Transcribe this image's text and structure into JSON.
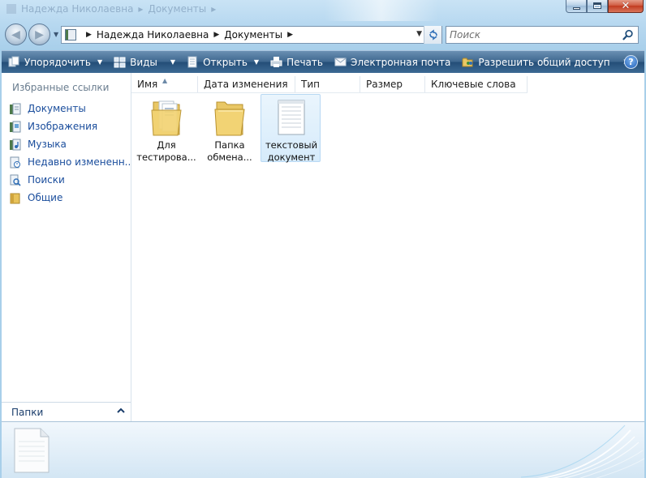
{
  "window": {
    "ghost_title_parts": [
      "Надежда Николаевна",
      "Документы"
    ],
    "caption_buttons": {
      "minimize": "minimize",
      "maximize": "maximize",
      "close": "close"
    }
  },
  "address_bar": {
    "breadcrumbs": [
      "Надежда Николаевна",
      "Документы"
    ]
  },
  "search": {
    "placeholder": "Поиск"
  },
  "toolbar": {
    "organize": "Упорядочить",
    "views": "Виды",
    "open": "Открыть",
    "print": "Печать",
    "email": "Электронная почта",
    "share": "Разрешить общий доступ",
    "more": "»",
    "help": "?"
  },
  "nav_pane": {
    "title": "Избранные ссылки",
    "items": [
      {
        "label": "Документы",
        "icon": "documents-icon"
      },
      {
        "label": "Изображения",
        "icon": "pictures-icon"
      },
      {
        "label": "Музыка",
        "icon": "music-icon"
      },
      {
        "label": "Недавно измененн...",
        "icon": "recent-icon"
      },
      {
        "label": "Поиски",
        "icon": "searches-icon"
      },
      {
        "label": "Общие",
        "icon": "public-icon"
      }
    ],
    "folders_label": "Папки"
  },
  "columns": [
    "Имя",
    "Дата изменения",
    "Тип",
    "Размер",
    "Ключевые слова"
  ],
  "files": [
    {
      "line1": "Для",
      "line2": "тестирова...",
      "kind": "folder-with-documents"
    },
    {
      "line1": "Папка",
      "line2": "обмена...",
      "kind": "folder"
    },
    {
      "line1": "текстовый",
      "line2": "документ",
      "kind": "text-document",
      "selected": true
    }
  ]
}
